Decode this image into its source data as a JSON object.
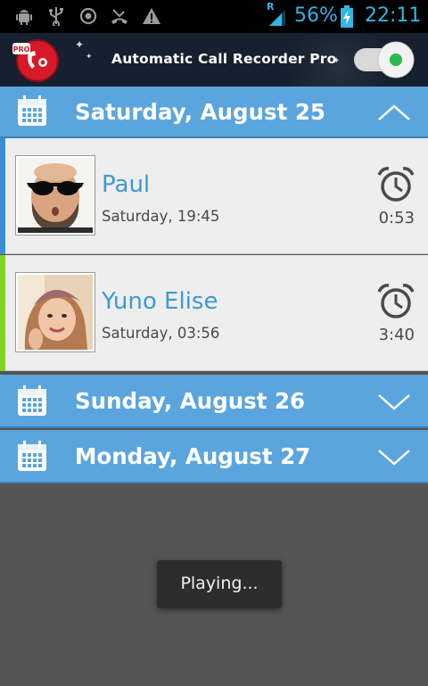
{
  "status_bar": {
    "battery_percent": "56%",
    "time": "22:11",
    "network_label": "R",
    "icons": [
      "android-debug-icon",
      "usb-icon",
      "sync-icon",
      "missed-call-icon",
      "warning-icon",
      "signal-icon",
      "battery-charging-icon"
    ],
    "accent_color": "#33b5e5"
  },
  "app": {
    "title": "Automatic Call Recorder Pro",
    "logo_badge": "PRO",
    "recording_enabled": true
  },
  "days": [
    {
      "label": "Saturday, August 25",
      "expanded": true,
      "calls": [
        {
          "name": "Paul",
          "time": "Saturday, 19:45",
          "duration": "0:53",
          "accent_color": "#3b8fd8",
          "avatar": "man-with-sunglasses-photo"
        },
        {
          "name": "Yuno Elise",
          "time": "Saturday, 03:56",
          "duration": "3:40",
          "accent_color": "#7ed321",
          "avatar": "woman-with-beanie-photo"
        }
      ]
    },
    {
      "label": "Sunday, August 26",
      "expanded": false,
      "calls": []
    },
    {
      "label": "Monday, August 27",
      "expanded": false,
      "calls": []
    }
  ],
  "toast": {
    "text": "Playing..."
  },
  "colors": {
    "day_header": "#5ba5de",
    "name_text": "#3d9ad1",
    "background": "#555555"
  }
}
